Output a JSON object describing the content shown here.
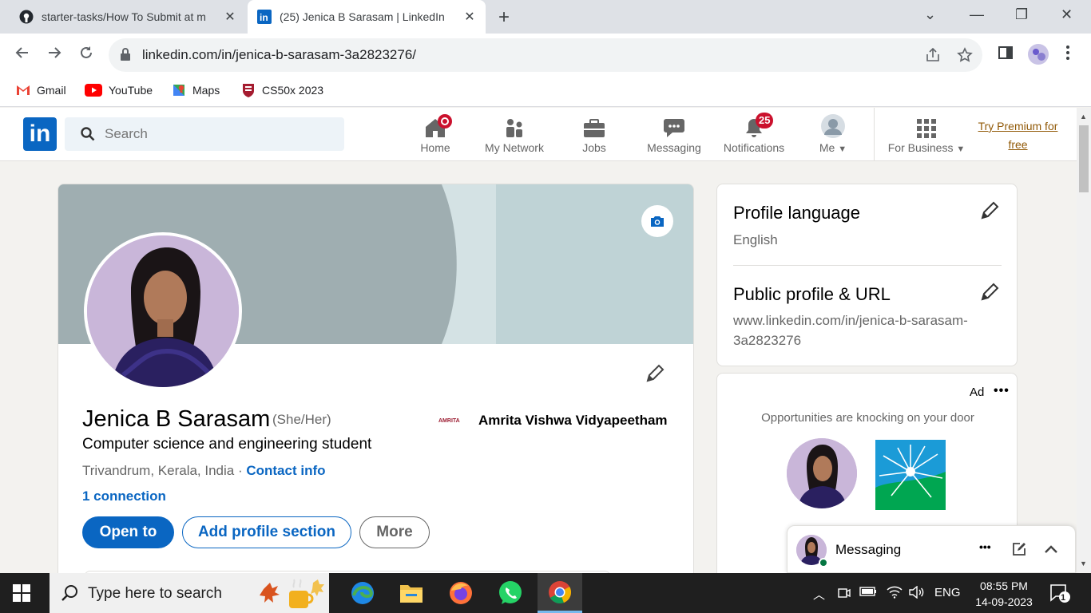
{
  "browser": {
    "tabs": [
      {
        "title": "starter-tasks/How To Submit at m",
        "active": false
      },
      {
        "title": "(25) Jenica B Sarasam | LinkedIn",
        "active": true
      }
    ],
    "url": "linkedin.com/in/jenica-b-sarasam-3a2823276/",
    "bookmarks": [
      {
        "label": "Gmail",
        "icon": "gmail-icon"
      },
      {
        "label": "YouTube",
        "icon": "youtube-icon"
      },
      {
        "label": "Maps",
        "icon": "maps-icon"
      },
      {
        "label": "CS50x 2023",
        "icon": "harvard-icon"
      }
    ]
  },
  "linkedin": {
    "search_placeholder": "Search",
    "nav": [
      {
        "label": "Home",
        "icon": "home-icon"
      },
      {
        "label": "My Network",
        "icon": "network-icon"
      },
      {
        "label": "Jobs",
        "icon": "jobs-icon"
      },
      {
        "label": "Messaging",
        "icon": "messaging-icon"
      },
      {
        "label": "Notifications",
        "icon": "bell-icon",
        "badge": "25"
      },
      {
        "label": "Me",
        "icon": "avatar"
      },
      {
        "label": "For Business",
        "icon": "grid-icon"
      }
    ],
    "premium_line1": "Try Premium for",
    "premium_line2": "free",
    "brand_color": "#0a66c2"
  },
  "profile": {
    "name": "Jenica B Sarasam",
    "pronouns": "(She/Her)",
    "headline": "Computer science and engineering student",
    "location": "Trivandrum, Kerala, India",
    "separator": " · ",
    "contact_info": "Contact info",
    "connections": "1 connection",
    "education": "Amrita Vishwa Vidyapeetham",
    "education_logo_text": "AMRITA",
    "buttons": {
      "open_to": "Open to",
      "add_section": "Add profile section",
      "more": "More"
    }
  },
  "sidebar": {
    "language_title": "Profile language",
    "language_value": "English",
    "url_title": "Public profile & URL",
    "url_line1": "www.linkedin.com/in/jenica-b-sarasam-",
    "url_line2": "3a2823276"
  },
  "ad": {
    "label": "Ad",
    "text": "Opportunities are knocking on your door"
  },
  "messaging": {
    "title": "Messaging"
  },
  "taskbar": {
    "search_placeholder": "Type here to search",
    "language": "ENG",
    "time": "08:55 PM",
    "date": "14-09-2023",
    "notification_count": "1"
  }
}
